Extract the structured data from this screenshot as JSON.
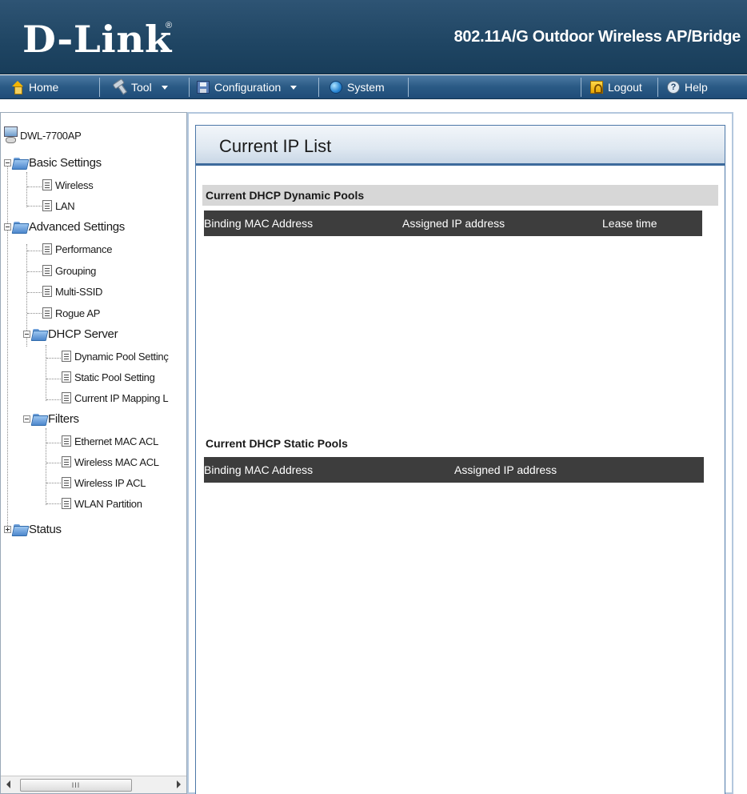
{
  "header": {
    "logo": "D-Link",
    "logo_mark": "®",
    "product_title": "802.11A/G Outdoor Wireless AP/Bridge"
  },
  "menubar": {
    "home": "Home",
    "tool": "Tool",
    "configuration": "Configuration",
    "system": "System",
    "logout": "Logout",
    "help": "Help"
  },
  "tree": {
    "root": "DWL-7700AP",
    "basic_settings": "Basic Settings",
    "wireless": "Wireless",
    "lan": "LAN",
    "advanced_settings": "Advanced Settings",
    "performance": "Performance",
    "grouping": "Grouping",
    "multi_ssid": "Multi-SSID",
    "rogue_ap": "Rogue AP",
    "dhcp_server": "DHCP Server",
    "dynamic_pool_setting": "Dynamic Pool Settinç",
    "static_pool_setting": "Static Pool Setting",
    "current_ip_mapping": "Current IP Mapping L",
    "filters": "Filters",
    "ethernet_mac_acl": "Ethernet MAC ACL",
    "wireless_mac_acl": "Wireless MAC ACL",
    "wireless_ip_acl": "Wireless IP ACL",
    "wlan_partition": "WLAN Partition",
    "status": "Status"
  },
  "scrollbar": {
    "thumb_grip": "III"
  },
  "content": {
    "title": "Current IP List",
    "dynamic_pools": {
      "heading": "Current DHCP Dynamic Pools",
      "columns": [
        "Binding MAC Address",
        "Assigned IP address",
        "Lease time"
      ],
      "rows": []
    },
    "static_pools": {
      "heading": "Current DHCP Static Pools",
      "columns": [
        "Binding MAC Address",
        "Assigned IP address"
      ],
      "rows": []
    }
  }
}
